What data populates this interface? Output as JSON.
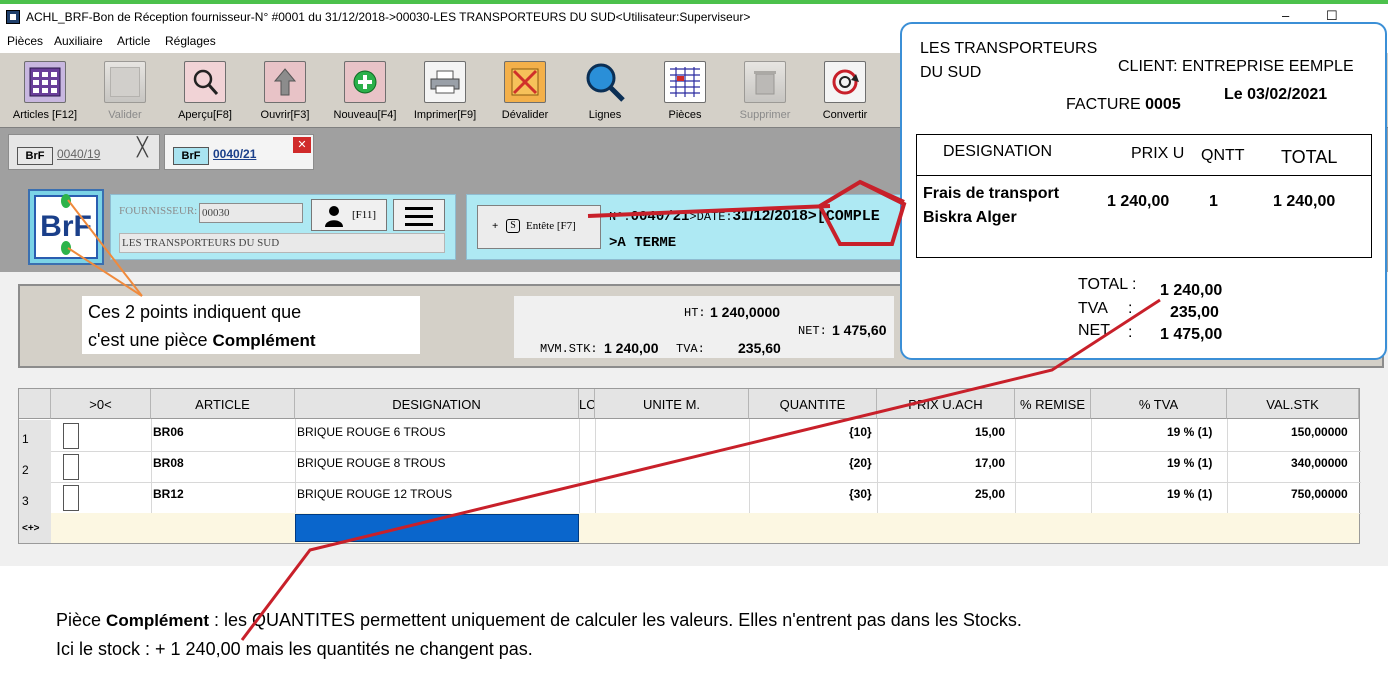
{
  "window": {
    "title": "ACHL_BRF-Bon de Réception fournisseur-N° #0001 du 31/12/2018->00030-LES TRANSPORTEURS DU SUD<Utilisateur:Superviseur>",
    "minimize": "–",
    "maximize": "☐"
  },
  "menu": [
    "Pièces",
    "Auxiliaire",
    "Article",
    "Réglages"
  ],
  "toolbar": [
    {
      "label": "Articles [F12]",
      "icon": "grid-icon",
      "enabled": true
    },
    {
      "label": "Valider",
      "icon": "validate-icon",
      "enabled": false
    },
    {
      "label": "Aperçu[F8]",
      "icon": "preview-icon",
      "enabled": true
    },
    {
      "label": "Ouvrir[F3]",
      "icon": "open-icon",
      "enabled": true
    },
    {
      "label": "Nouveau[F4]",
      "icon": "new-icon",
      "enabled": true
    },
    {
      "label": "Imprimer[F9]",
      "icon": "printer-icon",
      "enabled": true
    },
    {
      "label": "Dévalider",
      "icon": "unvalidate-icon",
      "enabled": true
    },
    {
      "label": "Lignes",
      "icon": "magnifier-icon",
      "enabled": true
    },
    {
      "label": "Pièces",
      "icon": "pieces-icon",
      "enabled": true
    },
    {
      "label": "Supprimer",
      "icon": "trash-icon",
      "enabled": false
    },
    {
      "label": "Convertir",
      "icon": "convert-icon",
      "enabled": true
    }
  ],
  "tabs": [
    {
      "badge": "BrF",
      "number": "0040/19",
      "close": "╳"
    },
    {
      "badge": "BrF",
      "number": "0040/21",
      "close": "✕"
    }
  ],
  "logo_text": "BrF",
  "supplier": {
    "label": "FOURNISSEUR:",
    "code": "00030",
    "name": "LES TRANSPORTEURS DU SUD",
    "person_button": "[F11]"
  },
  "header": {
    "button": "Entête [F7]",
    "plus": "+",
    "s_key": "S",
    "number_label": "N°:",
    "number": "0040/21",
    "date_label": ">DATE:",
    "date": "31/12/2018",
    "type": ">[COMPLE",
    "payment": ">A TERME"
  },
  "note": {
    "line1": "Ces 2 points indiquent que",
    "line2_prefix": "c'est une pièce",
    "line2_bold": "Complément"
  },
  "totals": {
    "ht_label": "HT:",
    "ht": "1 240,0000",
    "net_label": "NET:",
    "net": "1 475,60",
    "mvm_label": "MVM.STK:",
    "mvm": "1 240,00",
    "tva_label": "TVA:",
    "tva": "235,60"
  },
  "grid": {
    "columns": [
      ">0<",
      "ARTICLE",
      "DESIGNATION",
      "LC",
      "UNITE M.",
      "QUANTITE",
      "PRIX U.ACH",
      "% REMISE",
      "% TVA",
      "VAL.STK"
    ],
    "rows": [
      {
        "num": "1",
        "article": "BR06",
        "designation": "BRIQUE ROUGE 6 TROUS",
        "quantite": "{10}",
        "prix": "15,00",
        "tva": "19 % (1)",
        "valstk": "150,00000"
      },
      {
        "num": "2",
        "article": "BR08",
        "designation": "BRIQUE ROUGE 8 TROUS",
        "quantite": "{20}",
        "prix": "17,00",
        "tva": "19 % (1)",
        "valstk": "340,00000"
      },
      {
        "num": "3",
        "article": "BR12",
        "designation": "BRIQUE ROUGE 12 TROUS",
        "quantite": "{30}",
        "prix": "25,00",
        "tva": "19 % (1)",
        "valstk": "750,00000"
      }
    ],
    "new_row": "<+>"
  },
  "invoice": {
    "supplier_line1": "LES TRANSPORTEURS",
    "supplier_line2": "DU SUD",
    "client": "CLIENT: ENTREPRISE EEMPLE",
    "facture_label": "FACTURE",
    "facture_num": "0005",
    "date": "Le 03/02/2021",
    "headers": [
      "DESIGNATION",
      "PRIX U",
      "QNTT",
      "TOTAL"
    ],
    "item_line1": "Frais de transport",
    "item_line2": "Biskra Alger",
    "item_price": "1 240,00",
    "item_qty": "1",
    "item_total": "1 240,00",
    "total_label": "TOTAL :",
    "total": "1 240,00",
    "tva_label": "TVA",
    "tva_colon": ":",
    "tva": "235,00",
    "net_label": "NET",
    "net_colon": ":",
    "net": "1 475,00"
  },
  "bottom_note": {
    "line1_prefix": "Pièce",
    "line1_bold": "Complément",
    "line1_rest": ": les QUANTITES  permettent uniquement de calculer les valeurs. Elles n'entrent pas dans les Stocks.",
    "line2": "Ici le stock : + 1 240,00  mais les quantités ne changent pas."
  },
  "colors": {
    "accent_cyan": "#aee9f3",
    "annotation_red": "#c8202a",
    "annotation_orange": "#f08a3c",
    "invoice_border": "#3b8fd6",
    "selection_blue": "#0a66cc"
  }
}
